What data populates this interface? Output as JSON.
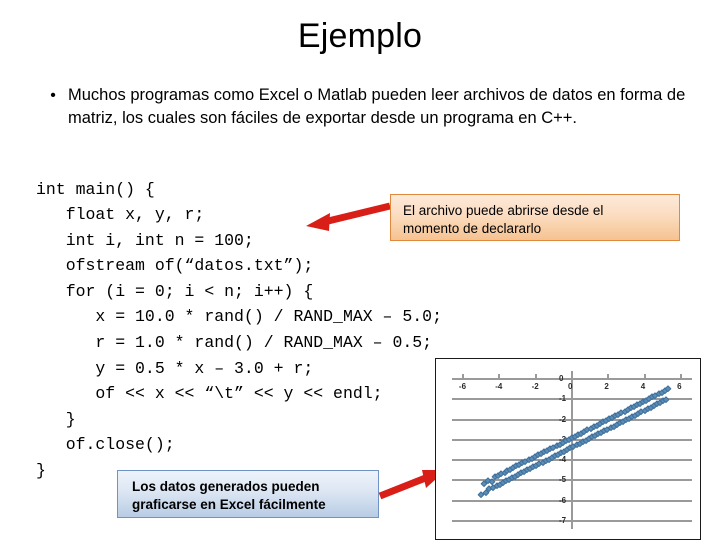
{
  "slide": {
    "title": "Ejemplo",
    "bullet": {
      "marker": "•",
      "text": "Muchos programas como Excel o Matlab pueden leer archivos de datos en forma de matriz, los cuales son fáciles de exportar desde un programa en C++."
    },
    "code": "int main() {\n   float x, y, r;\n   int i, int n = 100;\n   ofstream of(“datos.txt”);\n   for (i = 0; i < n; i++) {\n      x = 10.0 * rand() / RAND_MAX – 5.0;\n      r = 1.0 * rand() / RAND_MAX – 0.5;\n      y = 0.5 * x – 3.0 + r;\n      of << x << “\\t” << y << endl;\n   }\n   of.close();\n}",
    "callout_orange": {
      "line1": "El archivo puede abrirse desde el",
      "line2": "momento de declararlo",
      "fill_top": "#fdeada",
      "fill_bottom": "#f6c391",
      "border_color": "#e0883c"
    },
    "callout_blue": {
      "line1": "Los datos generados pueden",
      "line2": "graficarse en Excel fácilmente",
      "fill_top": "#eef3fa",
      "fill_bottom": "#b8cce4",
      "border_color": "#6e93c4"
    },
    "arrows": {
      "color": "#d91e18",
      "left_arrow_label": "arrow-to-code",
      "right_arrow_label": "arrow-to-chart"
    }
  },
  "chart_data": {
    "type": "scatter",
    "title": "",
    "xlabel": "",
    "ylabel": "",
    "xlim": [
      -6.6,
      6.6
    ],
    "ylim": [
      -7.4,
      0.4
    ],
    "xticks": [
      -6,
      -4,
      -2,
      0,
      2,
      4,
      6
    ],
    "xticklabels": [
      "-6",
      "-4",
      "-2",
      "0",
      "2",
      "4",
      "6"
    ],
    "yticks": [
      0,
      -1,
      -2,
      -3,
      -4,
      -5,
      -6,
      -7
    ],
    "yticklabels": [
      "0",
      "-1",
      "-2",
      "-3",
      "-4",
      "-5",
      "-6",
      "-7"
    ],
    "grid": "horizontal",
    "grid_color": "#9a9a9a",
    "legend": "none",
    "marker_color": "#5b8db8",
    "relation": "y = 0.5*x - 3.0 + r,  r uniform in [-0.5, 0.5]",
    "series": [
      {
        "name": "datos.txt",
        "x": [
          -5.01,
          -4.86,
          -4.72,
          -4.63,
          -4.55,
          -4.41,
          -4.33,
          -4.21,
          -4.12,
          -4.05,
          -3.95,
          -3.88,
          -3.79,
          -3.7,
          -3.62,
          -3.55,
          -3.47,
          -3.4,
          -3.31,
          -3.24,
          -3.15,
          -3.07,
          -2.98,
          -2.9,
          -2.81,
          -2.73,
          -2.64,
          -2.56,
          -2.47,
          -2.39,
          -2.3,
          -2.21,
          -2.13,
          -2.04,
          -1.96,
          -1.87,
          -1.79,
          -1.7,
          -1.62,
          -1.53,
          -1.45,
          -1.36,
          -1.28,
          -1.19,
          -1.11,
          -1.02,
          -0.94,
          -0.85,
          -0.77,
          -0.68,
          -0.6,
          -0.51,
          -0.43,
          -0.34,
          -0.26,
          -0.17,
          -0.09,
          0.0,
          0.08,
          0.17,
          0.25,
          0.34,
          0.42,
          0.51,
          0.59,
          0.68,
          0.76,
          0.85,
          0.93,
          1.02,
          1.1,
          1.19,
          1.27,
          1.36,
          1.44,
          1.53,
          1.61,
          1.7,
          1.78,
          1.87,
          1.95,
          2.04,
          2.12,
          2.21,
          2.29,
          2.38,
          2.46,
          2.55,
          2.63,
          2.72,
          2.8,
          2.89,
          2.97,
          3.06,
          3.14,
          3.23,
          3.31,
          3.4,
          3.48,
          3.57,
          3.65,
          3.74,
          3.82,
          3.91,
          3.99,
          4.08,
          4.16,
          4.25,
          4.33,
          4.42,
          4.5,
          4.59,
          4.67,
          4.76,
          4.84,
          4.93,
          5.01,
          5.1,
          5.18,
          5.27
        ],
        "y": [
          -5.71,
          -5.18,
          -5.6,
          -5.03,
          -5.44,
          -5.09,
          -5.38,
          -4.85,
          -5.29,
          -4.78,
          -5.21,
          -4.7,
          -5.12,
          -4.62,
          -5.05,
          -4.55,
          -4.97,
          -4.47,
          -4.9,
          -4.39,
          -4.82,
          -4.31,
          -4.74,
          -4.24,
          -4.66,
          -4.16,
          -4.59,
          -4.08,
          -4.51,
          -4.0,
          -4.43,
          -3.93,
          -4.35,
          -3.85,
          -4.28,
          -3.77,
          -4.2,
          -3.69,
          -4.12,
          -3.62,
          -4.04,
          -3.54,
          -3.97,
          -3.46,
          -3.89,
          -3.38,
          -3.81,
          -3.31,
          -3.73,
          -3.23,
          -3.66,
          -3.15,
          -3.58,
          -3.07,
          -3.5,
          -3.0,
          -3.42,
          -2.92,
          -3.35,
          -2.84,
          -3.27,
          -2.76,
          -3.19,
          -2.69,
          -3.11,
          -2.61,
          -3.04,
          -2.53,
          -2.96,
          -2.45,
          -2.88,
          -2.38,
          -2.8,
          -2.3,
          -2.73,
          -2.22,
          -2.65,
          -2.14,
          -2.57,
          -2.07,
          -2.49,
          -1.99,
          -2.42,
          -1.91,
          -2.34,
          -1.83,
          -2.26,
          -1.76,
          -2.18,
          -1.68,
          -2.11,
          -1.6,
          -2.03,
          -1.52,
          -1.95,
          -1.45,
          -1.87,
          -1.37,
          -1.8,
          -1.29,
          -1.72,
          -1.21,
          -1.64,
          -1.14,
          -1.56,
          -1.06,
          -1.49,
          -0.98,
          -1.41,
          -0.9,
          -1.33,
          -0.83,
          -1.25,
          -0.75,
          -1.18,
          -0.67,
          -1.1,
          -0.59,
          -1.02,
          -0.51
        ]
      }
    ]
  }
}
